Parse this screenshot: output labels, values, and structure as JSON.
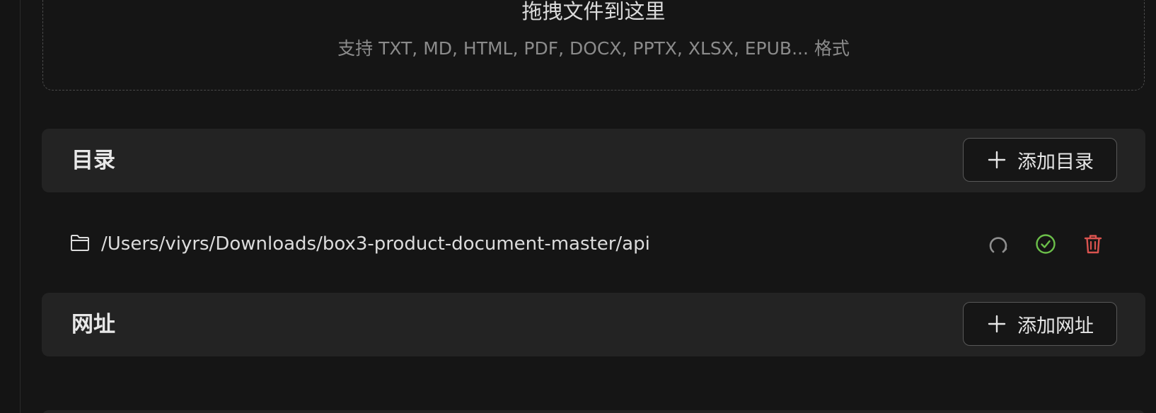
{
  "dropzone": {
    "title": "拖拽文件到这里",
    "hint": "支持 TXT, MD, HTML, PDF, DOCX, PPTX, XLSX, EPUB... 格式"
  },
  "directories": {
    "title": "目录",
    "add_label": "添加目录",
    "items": [
      {
        "path": "/Users/viyrs/Downloads/box3-product-document-master/api",
        "icon": "folder-icon",
        "actions": [
          {
            "name": "refresh",
            "icon": "refresh-icon",
            "color": "#8e8e8e"
          },
          {
            "name": "status",
            "icon": "check-circle-icon",
            "color": "#6cc04a"
          },
          {
            "name": "delete",
            "icon": "trash-icon",
            "color": "#d9534f"
          }
        ]
      }
    ]
  },
  "urls": {
    "title": "网址",
    "add_label": "添加网址"
  },
  "colors": {
    "background": "#151515",
    "panel": "#232323",
    "success": "#6cc04a",
    "danger": "#d9534f"
  }
}
